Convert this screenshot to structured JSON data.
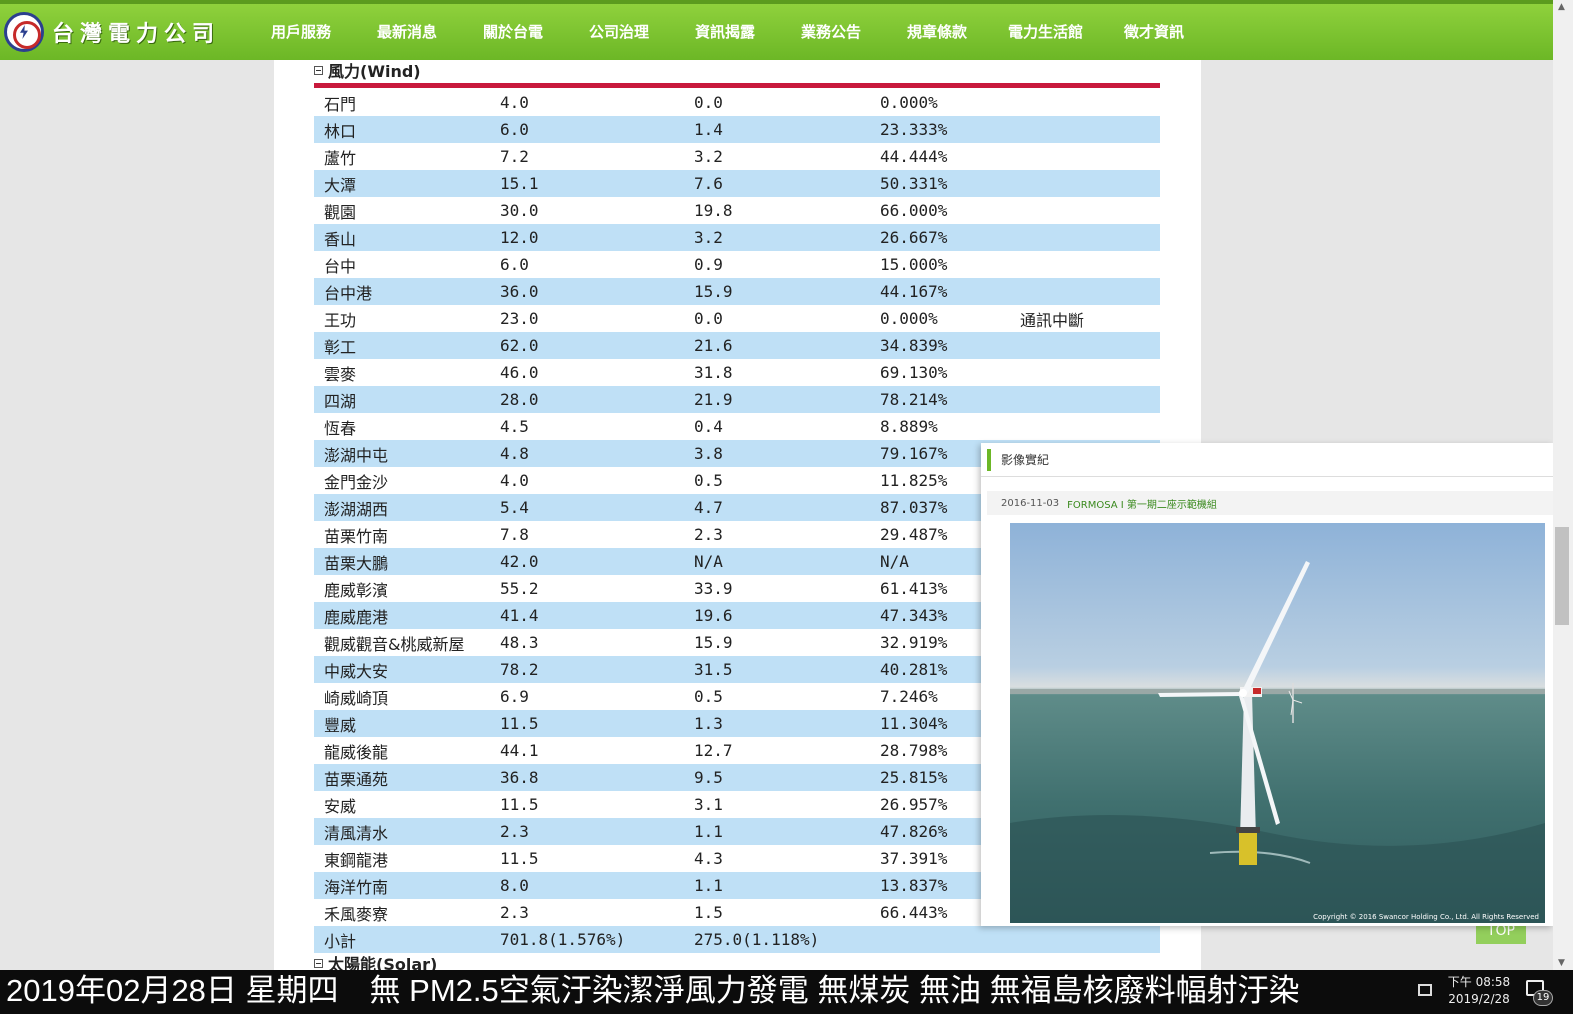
{
  "header": {
    "logo_text": "台灣電力公司",
    "nav": [
      "用戶服務",
      "最新消息",
      "關於台電",
      "公司治理",
      "資訊揭露",
      "業務公告",
      "規章條款",
      "電力生活館",
      "徵才資訊"
    ],
    "active_index": 4
  },
  "section": {
    "title": "風力(Wind)",
    "next_title": "太陽能(Solar)",
    "rows": [
      {
        "name": "石門",
        "capacity": "4.0",
        "output": "0.0",
        "ratio": "0.000%",
        "note": ""
      },
      {
        "name": "林口",
        "capacity": "6.0",
        "output": "1.4",
        "ratio": "23.333%",
        "note": ""
      },
      {
        "name": "蘆竹",
        "capacity": "7.2",
        "output": "3.2",
        "ratio": "44.444%",
        "note": ""
      },
      {
        "name": "大潭",
        "capacity": "15.1",
        "output": "7.6",
        "ratio": "50.331%",
        "note": ""
      },
      {
        "name": "觀園",
        "capacity": "30.0",
        "output": "19.8",
        "ratio": "66.000%",
        "note": ""
      },
      {
        "name": "香山",
        "capacity": "12.0",
        "output": "3.2",
        "ratio": "26.667%",
        "note": ""
      },
      {
        "name": "台中",
        "capacity": "6.0",
        "output": "0.9",
        "ratio": "15.000%",
        "note": ""
      },
      {
        "name": "台中港",
        "capacity": "36.0",
        "output": "15.9",
        "ratio": "44.167%",
        "note": ""
      },
      {
        "name": "王功",
        "capacity": "23.0",
        "output": "0.0",
        "ratio": "0.000%",
        "note": "通訊中斷"
      },
      {
        "name": "彰工",
        "capacity": "62.0",
        "output": "21.6",
        "ratio": "34.839%",
        "note": ""
      },
      {
        "name": "雲麥",
        "capacity": "46.0",
        "output": "31.8",
        "ratio": "69.130%",
        "note": ""
      },
      {
        "name": "四湖",
        "capacity": "28.0",
        "output": "21.9",
        "ratio": "78.214%",
        "note": ""
      },
      {
        "name": "恆春",
        "capacity": "4.5",
        "output": "0.4",
        "ratio": "8.889%",
        "note": ""
      },
      {
        "name": "澎湖中屯",
        "capacity": "4.8",
        "output": "3.8",
        "ratio": "79.167%",
        "note": ""
      },
      {
        "name": "金門金沙",
        "capacity": "4.0",
        "output": "0.5",
        "ratio": "11.825%",
        "note": ""
      },
      {
        "name": "澎湖湖西",
        "capacity": "5.4",
        "output": "4.7",
        "ratio": "87.037%",
        "note": ""
      },
      {
        "name": "苗栗竹南",
        "capacity": "7.8",
        "output": "2.3",
        "ratio": "29.487%",
        "note": ""
      },
      {
        "name": "苗栗大鵬",
        "capacity": "42.0",
        "output": "N/A",
        "ratio": "N/A",
        "note": ""
      },
      {
        "name": "鹿威彰濱",
        "capacity": "55.2",
        "output": "33.9",
        "ratio": "61.413%",
        "note": ""
      },
      {
        "name": "鹿威鹿港",
        "capacity": "41.4",
        "output": "19.6",
        "ratio": "47.343%",
        "note": ""
      },
      {
        "name": "觀威觀音&桃威新屋",
        "capacity": "48.3",
        "output": "15.9",
        "ratio": "32.919%",
        "note": ""
      },
      {
        "name": "中威大安",
        "capacity": "78.2",
        "output": "31.5",
        "ratio": "40.281%",
        "note": ""
      },
      {
        "name": "崎威崎頂",
        "capacity": "6.9",
        "output": "0.5",
        "ratio": "7.246%",
        "note": ""
      },
      {
        "name": "豐威",
        "capacity": "11.5",
        "output": "1.3",
        "ratio": "11.304%",
        "note": ""
      },
      {
        "name": "龍威後龍",
        "capacity": "44.1",
        "output": "12.7",
        "ratio": "28.798%",
        "note": ""
      },
      {
        "name": "苗栗通苑",
        "capacity": "36.8",
        "output": "9.5",
        "ratio": "25.815%",
        "note": ""
      },
      {
        "name": "安威",
        "capacity": "11.5",
        "output": "3.1",
        "ratio": "26.957%",
        "note": ""
      },
      {
        "name": "清風清水",
        "capacity": "2.3",
        "output": "1.1",
        "ratio": "47.826%",
        "note": ""
      },
      {
        "name": "東鋼龍港",
        "capacity": "11.5",
        "output": "4.3",
        "ratio": "37.391%",
        "note": ""
      },
      {
        "name": "海洋竹南",
        "capacity": "8.0",
        "output": "1.1",
        "ratio": "13.837%",
        "note": ""
      },
      {
        "name": "禾風麥寮",
        "capacity": "2.3",
        "output": "1.5",
        "ratio": "66.443%",
        "note": ""
      },
      {
        "name": "小計",
        "capacity": "701.8(1.576%)",
        "output": "275.0(1.118%)",
        "ratio": "",
        "note": ""
      }
    ]
  },
  "popup": {
    "title": "影像實紀",
    "date": "2016-11-03",
    "caption": "FORMOSA I 第一期二座示範機組",
    "copyright": "Copyright © 2016 Swancor Holding Co., Ltd. All Rights Reserved"
  },
  "top_button": "TOP",
  "ticker": "2019年02月28日 星期四　無 PM2.5空氣汙染潔淨風力發電 無煤炭 無油 無福島核廢料幅射汙染",
  "taskbar": {
    "time": "下午 08:58",
    "date": "2019/2/28",
    "notifications": "19"
  },
  "colors": {
    "nav_green": "#6cb726",
    "row_blue": "#bfe0f6",
    "header_red": "#c8193c"
  }
}
